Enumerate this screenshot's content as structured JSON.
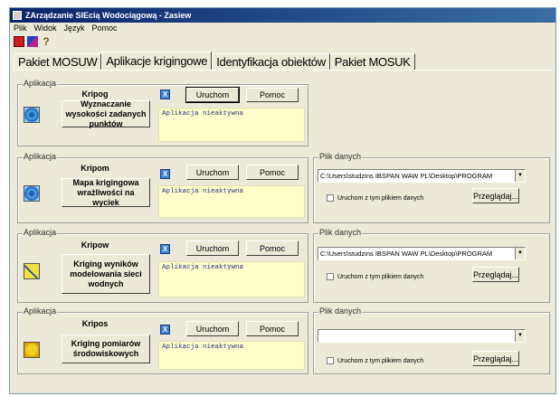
{
  "window": {
    "title": "ZArządzanie SIEcią Wodociągową - Zasiew"
  },
  "menu": [
    "Plik",
    "Widok",
    "Język",
    "Pomoc"
  ],
  "toolbar": {
    "icons": [
      "save-icon",
      "palette-icon",
      "help-icon"
    ],
    "help_glyph": "?"
  },
  "tabs": [
    {
      "label": "Pakiet MOSUW",
      "active": false
    },
    {
      "label": "Aplikacje krigingowe",
      "active": true
    },
    {
      "label": "Identyfikacja obiektów",
      "active": false
    },
    {
      "label": "Pakiet MOSUK",
      "active": false
    }
  ],
  "groups": [
    {
      "legend": "Aplikacja",
      "name": "Kripog",
      "button": "Wyznaczanie wysokości zadanych punktów",
      "run": "Uruchom",
      "help": "Pomoc",
      "status": "Aplikacja nieaktywna",
      "x_glyph": "X",
      "icon": "surface-icon"
    },
    {
      "legend": "Aplikacja",
      "name": "Kripom",
      "button": "Mapa krigingowa wrażliwości na wyciek",
      "run": "Uruchom",
      "help": "Pomoc",
      "status": "Aplikacja nieaktywna",
      "x_glyph": "X",
      "icon": "surface-icon",
      "file_legend": "Plik danych",
      "file_path": "C:\\Users\\studzins IBSPAN WAW PL\\Desktop\\PROGRAM",
      "file_check": "Uruchom z tym plikiem danych",
      "browse": "Przeglądaj..."
    },
    {
      "legend": "Aplikacja",
      "name": "Kripow",
      "button": "Kriging wyników modelowania sieci wodnych",
      "run": "Uruchom",
      "help": "Pomoc",
      "status": "Aplikacja nieaktywna",
      "x_glyph": "X",
      "icon": "network-icon",
      "file_legend": "Plik danych",
      "file_path": "C:\\Users\\studzins IBSPAN WAW PL\\Desktop\\PROGRAM",
      "file_check": "Uruchom z tym plikiem danych",
      "browse": "Przeglądaj..."
    },
    {
      "legend": "Aplikacja",
      "name": "Kripos",
      "button": "Kriging pomiarów środowiskowych",
      "run": "Uruchom",
      "help": "Pomoc",
      "status": "Aplikacja nieaktywna",
      "x_glyph": "X",
      "icon": "environment-icon",
      "file_legend": "Plik danych",
      "file_path": "",
      "file_check": "Uruchom z tym plikiem danych",
      "browse": "Przeglądaj..."
    }
  ],
  "colors": {
    "status_bg": "#ffffcc",
    "titlebar": "#0a246a",
    "accent": "#3a7fd0"
  }
}
